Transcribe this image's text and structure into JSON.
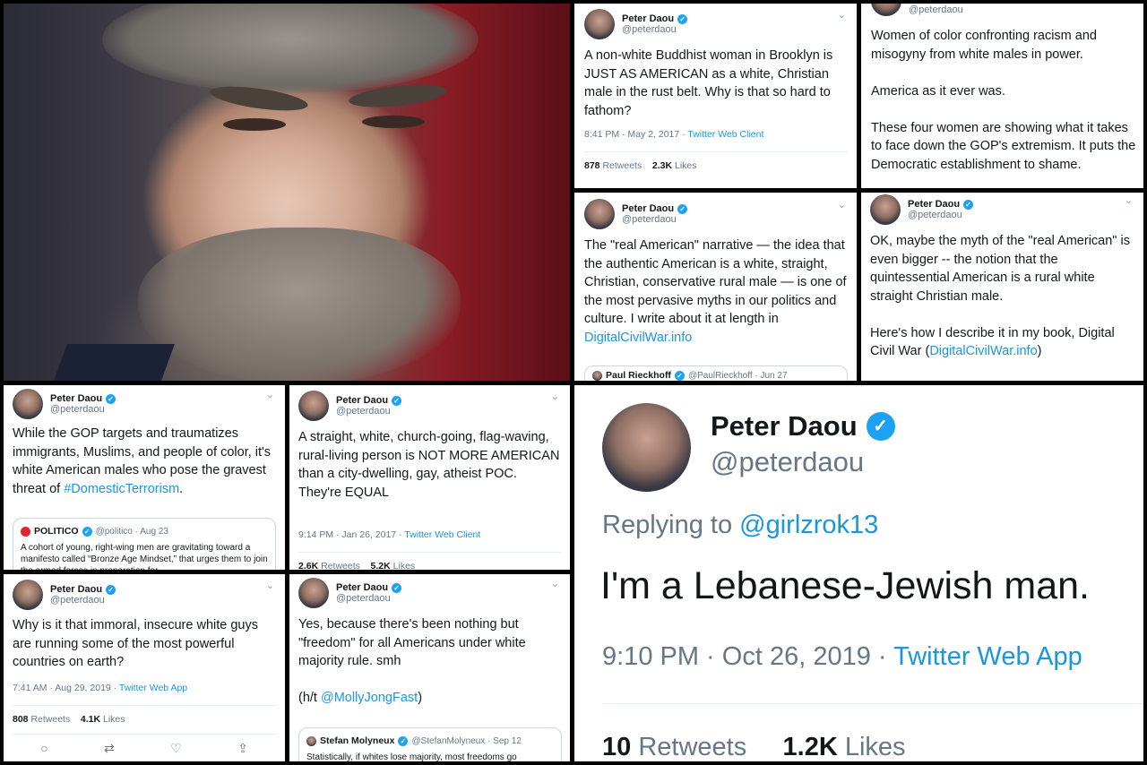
{
  "author": {
    "name": "Peter Daou",
    "handle": "@peterdaou"
  },
  "colors": {
    "link": "#1b95e0",
    "verified": "#1da1f2",
    "muted": "#657786"
  },
  "tweet1": {
    "text": "A non-white Buddhist woman in Brooklyn is JUST AS AMERICAN as a white, Christian male in the rust belt. Why is that so hard to fathom?",
    "time": "8:41 PM · May 2, 2017 · ",
    "client": "Twitter Web Client",
    "retweets": "878",
    "retweets_label": " Retweets",
    "likes": "2.3K",
    "likes_label": " Likes"
  },
  "tweet2": {
    "text": "Women of color confronting racism and misogyny from white males in power.\n\nAmerica as it ever was.\n\nThese four women are showing what it takes to face down the GOP's extremism. It puts the Democratic establishment to shame."
  },
  "tweet3": {
    "text": "The \"real American\" narrative — the idea that the authentic American is a white, straight, Christian, conservative rural male — is one of the most pervasive myths in our politics and culture. I write about it at length in ",
    "link": "DigitalCivilWar.info",
    "quote_name": "Paul Rieckhoff",
    "quote_handle": "@PaulRieckhoff · Jun 27"
  },
  "tweet4": {
    "text": "OK, maybe the myth of the \"real American\" is even bigger -- the notion that the quintessential American is a rural white straight Christian male.\n\nHere's how I describe it in my book, Digital Civil War (",
    "link": "DigitalCivilWar.info",
    "text_end": ")"
  },
  "tweet5": {
    "text": "While the GOP targets and traumatizes immigrants, Muslims, and people of color, it's white American males who pose the gravest threat of ",
    "link": "#DomesticTerrorism",
    "text_end": ".",
    "quote_name": "POLITICO",
    "quote_handle": "@politico · Aug 23",
    "quote_text": "A cohort of young, right-wing men are gravitating toward a manifesto called “Bronze Age Mindset,” that urges them to join the armed forces in preparation for"
  },
  "tweet6": {
    "text": "A straight, white, church-going, flag-waving, rural-living person is NOT MORE AMERICAN than a city-dwelling, gay, atheist POC.\nThey're EQUAL",
    "time": "9:14 PM · Jan 26, 2017 · ",
    "client": "Twitter Web Client",
    "retweets": "2.6K",
    "retweets_label": " Retweets",
    "likes": "5.2K",
    "likes_label": " Likes"
  },
  "tweet7": {
    "text": "Why is it that immoral, insecure white guys are running some of the most powerful countries on earth?",
    "time": "7:41 AM · Aug 29, 2019 · ",
    "client": "Twitter Web App",
    "retweets": "808",
    "retweets_label": " Retweets",
    "likes": "4.1K",
    "likes_label": " Likes"
  },
  "tweet8": {
    "text": "Yes, because there's been nothing but \"freedom\" for all Americans under white majority rule. smh\n\n(h/t ",
    "link": "@MollyJongFast",
    "text_end": ")",
    "quote_name": "Stefan Molyneux",
    "quote_handle": "@StefanMolyneux · Sep 12",
    "quote_text": "Statistically, if whites lose majority, most freedoms go"
  },
  "tweet9": {
    "replying_prefix": "Replying to ",
    "replying_to": "@girlzrok13",
    "text": "I'm a Lebanese-Jewish man.",
    "time": "9:10 PM · Oct 26, 2019 · ",
    "client": "Twitter Web App",
    "retweets": "10",
    "retweets_label": " Retweets",
    "likes": "1.2K",
    "likes_label": " Likes"
  },
  "icons": [
    "verified-icon",
    "chevron-down-icon",
    "reply-icon",
    "retweet-icon",
    "like-icon",
    "share-icon"
  ]
}
